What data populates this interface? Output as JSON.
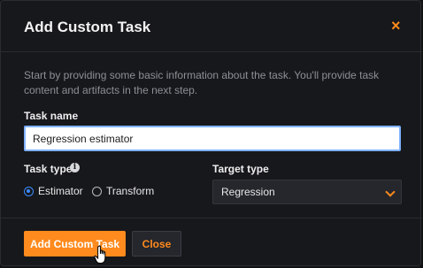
{
  "dialog": {
    "title": "Add Custom Task",
    "close_glyph": "×",
    "description": "Start by providing some basic information about the task. You'll provide task content and artifacts in the next step."
  },
  "form": {
    "task_name": {
      "label": "Task name",
      "value": "Regression estimator"
    },
    "task_type": {
      "label": "Task type",
      "info_icon": "info-icon",
      "options": [
        {
          "label": "Estimator",
          "selected": true
        },
        {
          "label": "Transform",
          "selected": false
        }
      ]
    },
    "target_type": {
      "label": "Target type",
      "value": "Regression"
    }
  },
  "buttons": {
    "primary": "Add Custom Task",
    "secondary": "Close"
  },
  "colors": {
    "accent": "#ff8a1d",
    "radio_selected": "#3b8cff",
    "input_focus_border": "#7fb2ff",
    "background": "#17181b"
  }
}
